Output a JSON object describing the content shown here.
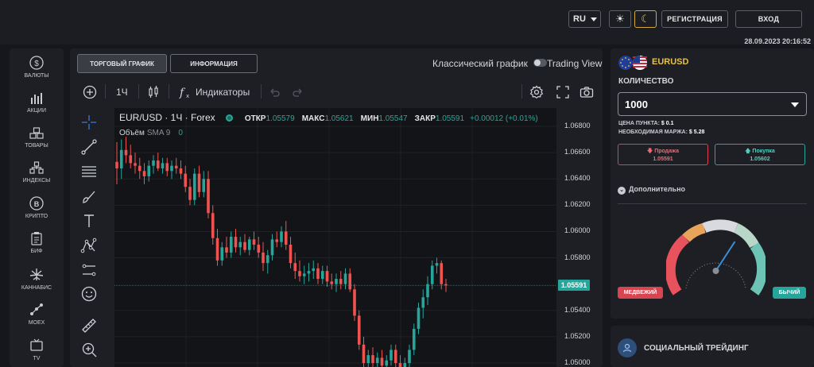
{
  "header": {
    "language": "RU",
    "register_label": "РЕГИСТРАЦИЯ",
    "login_label": "ВХОД",
    "datetime": "28.09.2023 20:16:52"
  },
  "sidebar": {
    "items": [
      {
        "label": "ВАЛЮТЫ",
        "icon": "currency-icon"
      },
      {
        "label": "АКЦИИ",
        "icon": "stocks-icon"
      },
      {
        "label": "ТОВАРЫ",
        "icon": "commodities-icon"
      },
      {
        "label": "ИНДЕКСЫ",
        "icon": "indices-icon"
      },
      {
        "label": "КРИПТО",
        "icon": "crypto-icon"
      },
      {
        "label": "БИФ",
        "icon": "etf-icon"
      },
      {
        "label": "КАННАБИС",
        "icon": "cannabis-icon"
      },
      {
        "label": "MOEX",
        "icon": "moex-icon"
      },
      {
        "label": "TV",
        "icon": "tv-icon"
      }
    ]
  },
  "chart_panel": {
    "tabs": [
      "ТОРГОВЫЙ ГРАФИК",
      "ИНФОРМАЦИЯ"
    ],
    "classic_label": "Классический график",
    "tradingview_label": "Trading View",
    "toolbar": {
      "interval": "1Ч",
      "indicators": "Индикаторы"
    },
    "legend": {
      "symbol": "EUR/USD · 1Ч · Forex",
      "open_label": "ОТКР",
      "open": "1.05579",
      "high_label": "МАКС",
      "high": "1.05621",
      "low_label": "МИН",
      "low": "1.05547",
      "close_label": "ЗАКР",
      "close": "1.05591",
      "change": "+0.00012 (+0.01%)"
    },
    "volume": {
      "label": "Объём",
      "sma": "SMA 9",
      "value": "0"
    },
    "last_price": "1.05591"
  },
  "chart_data": {
    "type": "candlestick",
    "title": "EUR/USD · 1Ч · Forex",
    "y_ticks": [
      "1.06800",
      "1.06600",
      "1.06400",
      "1.06200",
      "1.06000",
      "1.05800",
      "1.05400",
      "1.05200",
      "1.05000"
    ],
    "ylim": [
      1.0497,
      1.0692
    ],
    "up_color": "#26a69a",
    "down_color": "#ef5350",
    "candles": [
      [
        1.0653,
        1.0668,
        1.0636,
        1.0648
      ],
      [
        1.0648,
        1.067,
        1.064,
        1.0662
      ],
      [
        1.0662,
        1.0672,
        1.0652,
        1.0658
      ],
      [
        1.0658,
        1.0666,
        1.0648,
        1.0652
      ],
      [
        1.0652,
        1.066,
        1.0644,
        1.065
      ],
      [
        1.065,
        1.0656,
        1.064,
        1.0646
      ],
      [
        1.0646,
        1.0652,
        1.0636,
        1.0642
      ],
      [
        1.0642,
        1.0654,
        1.0638,
        1.065
      ],
      [
        1.065,
        1.0658,
        1.0644,
        1.0654
      ],
      [
        1.0654,
        1.066,
        1.0646,
        1.0648
      ],
      [
        1.0648,
        1.0656,
        1.0644,
        1.0652
      ],
      [
        1.0652,
        1.0656,
        1.0642,
        1.0646
      ],
      [
        1.0646,
        1.0654,
        1.064,
        1.065
      ],
      [
        1.065,
        1.0656,
        1.0644,
        1.0648
      ],
      [
        1.0648,
        1.0654,
        1.064,
        1.0644
      ],
      [
        1.0644,
        1.065,
        1.063,
        1.0634
      ],
      [
        1.0634,
        1.064,
        1.062,
        1.0624
      ],
      [
        1.0624,
        1.0648,
        1.062,
        1.0644
      ],
      [
        1.0644,
        1.065,
        1.0626,
        1.063
      ],
      [
        1.063,
        1.0646,
        1.0626,
        1.064
      ],
      [
        1.064,
        1.0646,
        1.061,
        1.0614
      ],
      [
        1.0614,
        1.062,
        1.059,
        1.0595
      ],
      [
        1.0595,
        1.0602,
        1.0574,
        1.0578
      ],
      [
        1.0578,
        1.0592,
        1.0574,
        1.0588
      ],
      [
        1.0588,
        1.0596,
        1.058,
        1.0584
      ],
      [
        1.0584,
        1.06,
        1.058,
        1.0596
      ],
      [
        1.0596,
        1.0602,
        1.0584,
        1.0588
      ],
      [
        1.0588,
        1.0596,
        1.0582,
        1.0592
      ],
      [
        1.0592,
        1.0598,
        1.0584,
        1.0586
      ],
      [
        1.0586,
        1.0596,
        1.0582,
        1.0594
      ],
      [
        1.0594,
        1.06,
        1.0586,
        1.059
      ],
      [
        1.059,
        1.0596,
        1.058,
        1.0584
      ],
      [
        1.0584,
        1.0592,
        1.057,
        1.0576
      ],
      [
        1.0576,
        1.0586,
        1.0568,
        1.0582
      ],
      [
        1.0582,
        1.0598,
        1.0578,
        1.0594
      ],
      [
        1.0594,
        1.06,
        1.0588,
        1.0592
      ],
      [
        1.0592,
        1.0604,
        1.0588,
        1.06
      ],
      [
        1.06,
        1.0608,
        1.0586,
        1.059
      ],
      [
        1.059,
        1.0596,
        1.0572,
        1.0576
      ],
      [
        1.0576,
        1.0584,
        1.0564,
        1.057
      ],
      [
        1.057,
        1.0578,
        1.0562,
        1.0566
      ],
      [
        1.0566,
        1.0574,
        1.056,
        1.0568
      ],
      [
        1.0568,
        1.0576,
        1.0562,
        1.057
      ],
      [
        1.057,
        1.0578,
        1.0564,
        1.0572
      ],
      [
        1.0572,
        1.0576,
        1.056,
        1.0564
      ],
      [
        1.0564,
        1.0574,
        1.056,
        1.057
      ],
      [
        1.057,
        1.0574,
        1.0558,
        1.0562
      ],
      [
        1.0562,
        1.0568,
        1.0556,
        1.056
      ],
      [
        1.056,
        1.0568,
        1.0554,
        1.0564
      ],
      [
        1.0564,
        1.057,
        1.0556,
        1.056
      ],
      [
        1.056,
        1.0572,
        1.0556,
        1.0568
      ],
      [
        1.0568,
        1.0572,
        1.0554,
        1.0556
      ],
      [
        1.0556,
        1.056,
        1.0532,
        1.0536
      ],
      [
        1.0536,
        1.054,
        1.051,
        1.0514
      ],
      [
        1.0514,
        1.052,
        1.0496,
        1.05
      ],
      [
        1.05,
        1.051,
        1.0494,
        1.0506
      ],
      [
        1.0506,
        1.0512,
        1.0496,
        1.05
      ],
      [
        1.05,
        1.0508,
        1.0494,
        1.0504
      ],
      [
        1.0504,
        1.051,
        1.0496,
        1.0498
      ],
      [
        1.0498,
        1.0506,
        1.0494,
        1.0502
      ],
      [
        1.0502,
        1.0514,
        1.0498,
        1.051
      ],
      [
        1.051,
        1.0514,
        1.0496,
        1.05
      ],
      [
        1.05,
        1.0506,
        1.0492,
        1.0496
      ],
      [
        1.0496,
        1.0504,
        1.0492,
        1.05
      ],
      [
        1.05,
        1.0514,
        1.0496,
        1.051
      ],
      [
        1.051,
        1.053,
        1.0506,
        1.0526
      ],
      [
        1.0526,
        1.0546,
        1.0522,
        1.0542
      ],
      [
        1.0542,
        1.0556,
        1.0534,
        1.055
      ],
      [
        1.055,
        1.0566,
        1.0544,
        1.056
      ],
      [
        1.056,
        1.0578,
        1.0556,
        1.0574
      ],
      [
        1.0574,
        1.058,
        1.0568,
        1.0576
      ],
      [
        1.0576,
        1.0578,
        1.0556,
        1.056
      ],
      [
        1.056,
        1.0564,
        1.0554,
        1.0559
      ]
    ]
  },
  "order_panel": {
    "pair": "EURUSD",
    "quantity_label": "КОЛИЧЕСТВО",
    "quantity_value": "1000",
    "pip_price_label": "ЦЕНА ПУНКТА:",
    "pip_price_value": "$ 0.1",
    "margin_label": "НЕОБХОДИМАЯ МАРЖА:",
    "margin_value": "$ 5.28",
    "sell_label": "Продажа",
    "sell_price": "1.05591",
    "buy_label": "Покупка",
    "buy_price": "1.05602",
    "extra_label": "Дополнительно",
    "bearish_label": "МЕДВЕЖИЙ",
    "bullish_label": "БЫЧИЙ",
    "sentiment": 0.7
  },
  "social": {
    "title": "СОЦИАЛЬНЫЙ ТРЕЙДИНГ"
  }
}
